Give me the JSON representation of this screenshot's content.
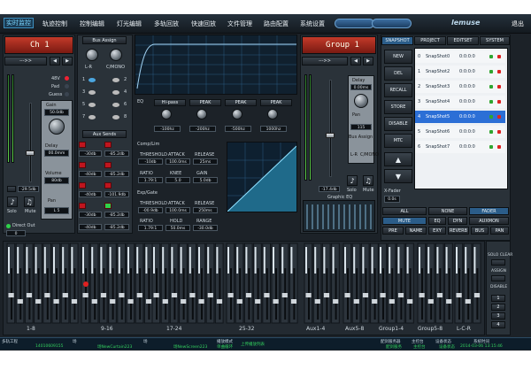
{
  "nav": {
    "tabs": [
      "实时监控",
      "轨迹控制",
      "控制编辑",
      "灯光编辑",
      "多轨回放",
      "快速回放",
      "文件管理",
      "路由配置",
      "系统设置"
    ],
    "pill_left": "",
    "pill_right": "",
    "brand": "lemuse",
    "exit": "退出"
  },
  "channel": {
    "name": "Ch 1",
    "route_arrow": "--->>",
    "labels_48v": "48V",
    "pad": "Pad",
    "guess": "Guess",
    "gain_label": "Gain",
    "gain_val": "50.0db",
    "delay_label": "Delay",
    "delay_val": "00.0mm",
    "volume_label": "Volume",
    "volume_val": "80db",
    "pan_label": "Pan",
    "pan_val": "L 5",
    "fader_val": "-29.5db",
    "solo": "Solo",
    "mute": "Mute",
    "direct_out": "Direct Out",
    "direct_out_val": "0"
  },
  "bus_assign": {
    "title": "Bus Assign",
    "lr": "L-R",
    "cmono": "C/MONO",
    "rows": [
      "1",
      "3",
      "5",
      "7"
    ],
    "rows_r": [
      "2",
      "4",
      "6",
      "8"
    ]
  },
  "aux_sends": {
    "title": "Aux Sends",
    "vals": [
      "-30db",
      "-85.2db",
      "-40db",
      "-85.2db",
      "-40db",
      "-101.9db",
      "-30db",
      "-85.2db",
      "-40db",
      "-85.2db"
    ],
    "nums": [
      "1",
      "2",
      "3",
      "4",
      "5",
      "6",
      "7",
      "8"
    ]
  },
  "eq": {
    "title": "EQ",
    "types": [
      "Hi-pass",
      "PEAK",
      "PEAK",
      "PEAK",
      "PEAK"
    ],
    "freq": [
      "-100hz",
      "-200hz",
      "-500hz",
      "1000hz",
      "5000hz"
    ]
  },
  "comp": {
    "title": "Comp/Lim",
    "threshold": "THRESHOLD",
    "attack": "ATTACK",
    "release": "RELEASE",
    "t_val": "-10db",
    "a_val": "100.0ms",
    "r_val": "25ms",
    "ratio": "RATIO",
    "knee": "KNEE",
    "gain": "GAIN",
    "ratio_val": "1.79:1",
    "knee_val": "5.0",
    "gain_val": "5.0db"
  },
  "gate": {
    "title": "Exp/Gate",
    "threshold": "THRESHOLD",
    "attack": "ATTACK",
    "release": "RELEASE",
    "t_val": "-00.9db",
    "a_val": "100.0ms",
    "r_val": "250ms",
    "ratio": "RATIO",
    "hold": "HOLD",
    "range": "RANGE",
    "ratio_val": "1.79:1",
    "hold_val": "50.0ms",
    "range_val": "-30.0db"
  },
  "group": {
    "name": "Group 1",
    "route_arrow": "--->>",
    "delay_label": "Delay",
    "delay_val": "0.00ms",
    "pan_label": "Pan",
    "pan_val": "115",
    "bus_assign": "Bus Assign",
    "lr": "L-R",
    "cmono": "C/MONO",
    "fader_val": "-17.4db",
    "solo": "Solo",
    "mute": "Mute",
    "graphic_eq": "Graphic EQ"
  },
  "snap_tabs": [
    "SNAPSHOT",
    "PROJECT",
    "EDITSET",
    "SYSTEM"
  ],
  "snap_btns": [
    "NEW",
    "DEL",
    "RECALL",
    "STORE",
    "DISABLE",
    "MTC"
  ],
  "snapshots": [
    {
      "n": "0",
      "name": "SnapShot0",
      "t": "0:0:0:0"
    },
    {
      "n": "1",
      "name": "SnapShot2",
      "t": "0:0:0:0"
    },
    {
      "n": "2",
      "name": "SnapShot3",
      "t": "0:0:0:0"
    },
    {
      "n": "3",
      "name": "SnapShot4",
      "t": "0:0:0:0"
    },
    {
      "n": "4",
      "name": "SnapShot5",
      "t": "0:0:0:0"
    },
    {
      "n": "5",
      "name": "SnapShot6",
      "t": "0:0:0:0"
    },
    {
      "n": "6",
      "name": "SnapShot7",
      "t": "0:0:0:0"
    }
  ],
  "xfader": {
    "label": "X-Fader",
    "val": "0.0s"
  },
  "filter_row1": [
    "ALL",
    "NONE",
    "FADER"
  ],
  "filter_row2": [
    "MUTE",
    "EQ",
    "DYN",
    "AUXMON"
  ],
  "filter_row3": [
    "PRE",
    "NAME",
    "EXY",
    "REVERB",
    "BUS",
    "PAN"
  ],
  "fader_groups": [
    "1-8",
    "9-16",
    "17-24",
    "25-32",
    "Aux1-4",
    "Aux5-8",
    "Group1-4",
    "Group5-8",
    "L-C-R"
  ],
  "right_side": {
    "solo_clear": "SOLO CLEAR",
    "assign": "ASSIGN",
    "disable": "DISABLE",
    "nums": [
      "1",
      "2",
      "3",
      "4"
    ]
  },
  "statusbar": {
    "project_label": "多轨工程",
    "project_val": "14010609155",
    "scene_label": "场",
    "scene_val": "场NewCurtain223",
    "view_label": "场",
    "view_val": "场NewScreen223",
    "mode_label": "播放模式",
    "mode_val": "单曲循环",
    "playlist": "上传播放列表",
    "server_label": "配剑服务器",
    "server_val": "配剑服务",
    "host_label": "主控台",
    "host_val": "主控台",
    "device_label": "设备状态",
    "device_val": "设备状态",
    "time_label": "系统时间",
    "time_val": "2014-03-06 13:15:46"
  }
}
